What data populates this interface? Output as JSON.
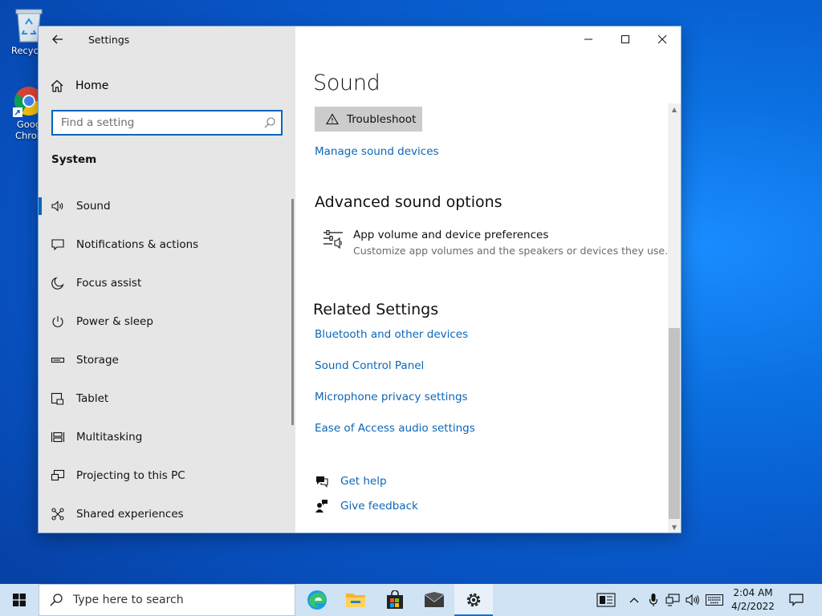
{
  "desktop": {
    "icons": [
      {
        "label": "Recycle",
        "icon": "recycle-bin-icon"
      },
      {
        "label": "Goog\nChron",
        "icon": "chrome-icon"
      }
    ]
  },
  "window": {
    "title": "Settings",
    "back_icon": "back-arrow-icon",
    "caption": {
      "minimize": "minimize-icon",
      "maximize": "maximize-icon",
      "close": "close-icon"
    }
  },
  "sidebar": {
    "home": {
      "label": "Home",
      "icon": "home-icon"
    },
    "search": {
      "placeholder": "Find a setting",
      "value": ""
    },
    "section": "System",
    "items": [
      {
        "label": "Sound",
        "icon": "speaker-icon",
        "active": true
      },
      {
        "label": "Notifications & actions",
        "icon": "notification-icon"
      },
      {
        "label": "Focus assist",
        "icon": "moon-icon"
      },
      {
        "label": "Power & sleep",
        "icon": "power-icon"
      },
      {
        "label": "Storage",
        "icon": "storage-icon"
      },
      {
        "label": "Tablet",
        "icon": "tablet-icon"
      },
      {
        "label": "Multitasking",
        "icon": "multitasking-icon"
      },
      {
        "label": "Projecting to this PC",
        "icon": "projecting-icon"
      },
      {
        "label": "Shared experiences",
        "icon": "shared-icon"
      }
    ]
  },
  "main": {
    "title": "Sound",
    "troubleshoot": "Troubleshoot",
    "manage_devices": "Manage sound devices",
    "advanced": {
      "heading": "Advanced sound options",
      "app_pref_title": "App volume and device preferences",
      "app_pref_desc": "Customize app volumes and the speakers or devices they use."
    },
    "related": {
      "heading": "Related Settings",
      "links": [
        "Bluetooth and other devices",
        "Sound Control Panel",
        "Microphone privacy settings",
        "Ease of Access audio settings"
      ]
    },
    "help": {
      "get_help": "Get help",
      "give_feedback": "Give feedback"
    }
  },
  "taskbar": {
    "search_placeholder": "Type here to search",
    "apps": [
      "edge-icon",
      "file-explorer-icon",
      "store-icon",
      "mail-icon",
      "settings-icon"
    ],
    "active_app": "settings-icon",
    "tray": [
      "people-icon",
      "chevron-up-icon",
      "microphone-icon",
      "network-icon",
      "volume-icon",
      "keyboard-icon"
    ],
    "time": "2:04 AM",
    "date": "4/2/2022",
    "notification_icon": "action-center-icon"
  },
  "colors": {
    "accent": "#0067c0",
    "link": "#0b66b8",
    "sidebar_bg": "#e6e6e6",
    "taskbar_bg": "#cfe3f4"
  }
}
